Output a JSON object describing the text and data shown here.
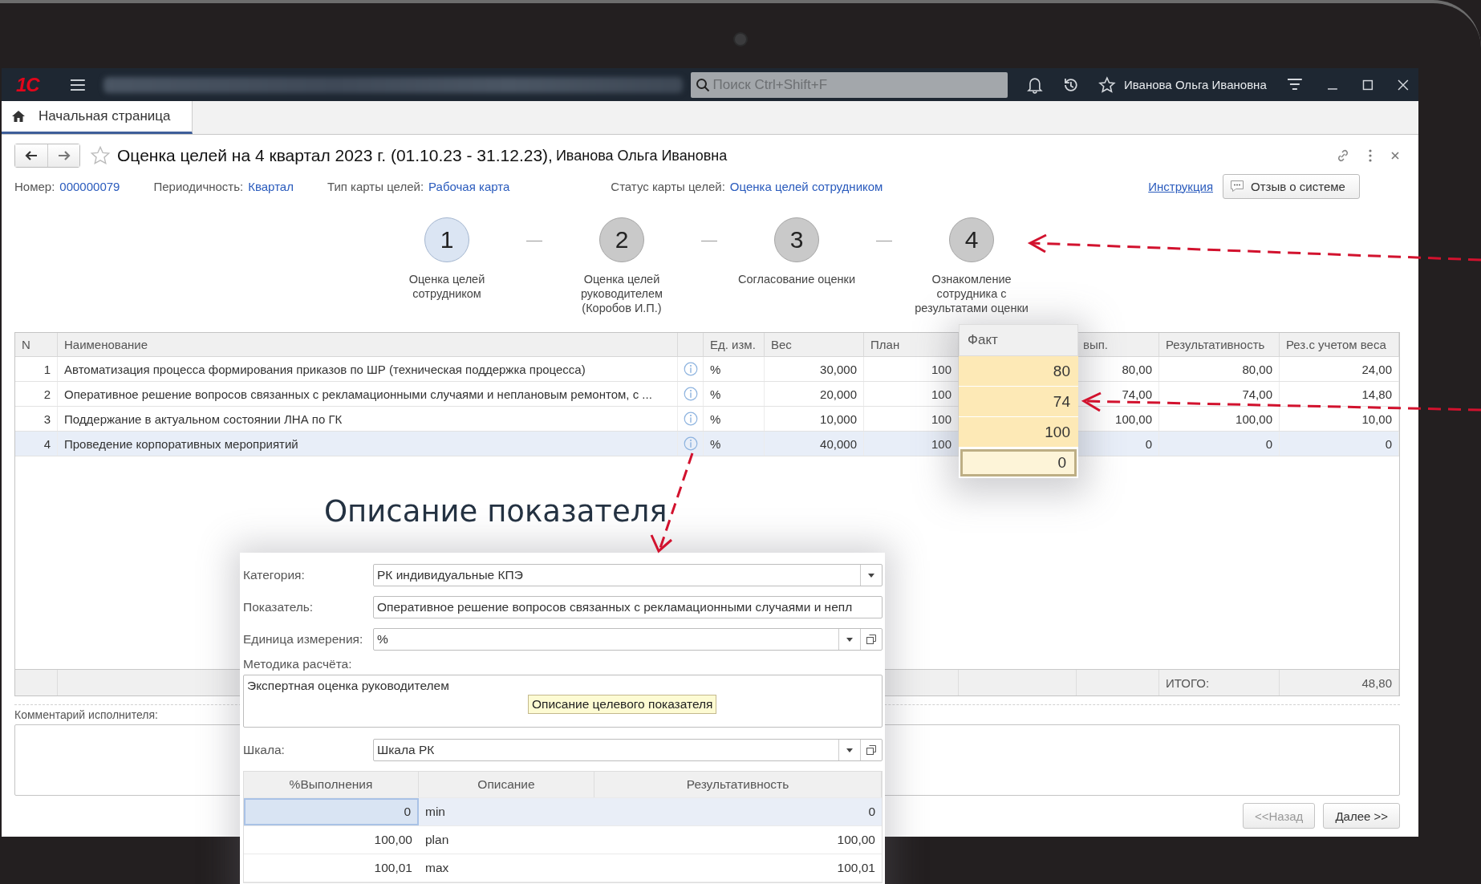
{
  "topbar": {
    "logo": "1С",
    "search_placeholder": "Поиск Ctrl+Shift+F",
    "user": "Иванова Ольга Ивановна"
  },
  "tabs": [
    {
      "label": "Начальная страница",
      "selected": true
    }
  ],
  "document": {
    "title": "Оценка целей на 4 квартал 2023 г. (01.10.23 - 31.12.23),",
    "subtitle": "Иванова Ольга Ивановна",
    "fields": [
      {
        "label": "Номер:",
        "value": "000000079"
      },
      {
        "label": "Периодичность:",
        "value": "Квартал"
      },
      {
        "label": "Тип карты целей:",
        "value": "Рабочая карта"
      },
      {
        "label": "Статус карты целей:",
        "value": "Оценка целей сотрудником"
      }
    ],
    "instruction_link": "Инструкция",
    "feedback_button": "Отзыв о системе"
  },
  "steps": [
    {
      "number": "1",
      "label": "Оценка целей сотрудником",
      "selected": true
    },
    {
      "number": "2",
      "label": "Оценка целей руководителем (Коробов И.П.)",
      "selected": false
    },
    {
      "number": "3",
      "label": "Согласование оценки",
      "selected": false
    },
    {
      "number": "4",
      "label": "Ознакомление сотрудника с результатами оценки",
      "selected": false
    }
  ],
  "table": {
    "columns": [
      "N",
      "Наименование",
      "Ед. изм.",
      "Вес",
      "План",
      "вып.",
      "Результативность",
      "Рез.с учетом веса"
    ],
    "rows": [
      {
        "n": "1",
        "name": "Автоматизация процесса формирования приказов по ШР (техническая поддержка процесса)",
        "unit": "%",
        "weight": "30,000",
        "plan": "100",
        "pct": "80,00",
        "result": "80,00",
        "weighted": "24,00",
        "selected": false
      },
      {
        "n": "2",
        "name": "Оперативное решение вопросов связанных с рекламационными случаями и неплановым ремонтом, с ...",
        "unit": "%",
        "weight": "20,000",
        "plan": "100",
        "pct": "74,00",
        "result": "74,00",
        "weighted": "14,80",
        "selected": false
      },
      {
        "n": "3",
        "name": "Поддержание в актуальном состоянии ЛНА по ГК",
        "unit": "%",
        "weight": "10,000",
        "plan": "100",
        "pct": "100,00",
        "result": "100,00",
        "weighted": "10,00",
        "selected": false
      },
      {
        "n": "4",
        "name": "Проведение корпоративных мероприятий",
        "unit": "%",
        "weight": "40,000",
        "plan": "100",
        "pct": "0",
        "result": "0",
        "weighted": "0",
        "selected": true
      }
    ],
    "total": {
      "label": "ИТОГО:",
      "value": "48,80"
    }
  },
  "fact_popup": {
    "header": "Факт",
    "cells": [
      {
        "value": "80",
        "editing": false
      },
      {
        "value": "74",
        "editing": false
      },
      {
        "value": "100",
        "editing": false
      },
      {
        "value": "0",
        "editing": true
      }
    ]
  },
  "comment": {
    "label": "Комментарий исполнителя:"
  },
  "buttons": [
    {
      "label": "<<Назад",
      "disabled": true
    },
    {
      "label": "Далее >>",
      "disabled": false
    }
  ],
  "callout": {
    "heading": "Описание показателя",
    "fields": [
      {
        "label": "Категория:",
        "value": "РК индивидуальные КПЭ",
        "kind": "dropdown"
      },
      {
        "label": "Показатель:",
        "value": "Оперативное решение вопросов связанных с рекламационными случаями и непл",
        "kind": "text"
      },
      {
        "label": "Единица измерения:",
        "value": "%",
        "kind": "dropdown_open"
      }
    ],
    "method_label": "Методика расчёта:",
    "method_text": "Экспертная оценка руководителем",
    "tooltip": "Описание целевого показателя",
    "scale_fields": [
      {
        "label": "Шкала:",
        "value": "Шкала РК",
        "kind": "dropdown_open"
      }
    ],
    "scale_table": {
      "columns": [
        "%Выполнения",
        "Описание",
        "Результативность"
      ],
      "rows": [
        {
          "percent": "0",
          "description": "min",
          "result": "0",
          "selected": true
        },
        {
          "percent": "100,00",
          "description": "plan",
          "result": "100,00",
          "selected": false
        },
        {
          "percent": "100,01",
          "description": "max",
          "result": "100,01",
          "selected": false
        }
      ]
    }
  }
}
